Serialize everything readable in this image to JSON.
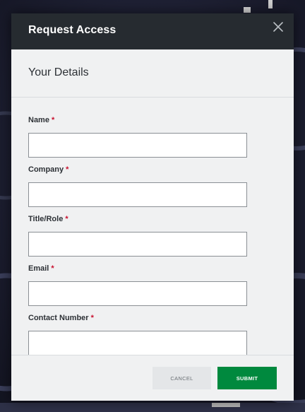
{
  "modal": {
    "title": "Request Access",
    "close_icon": "close-icon",
    "section_title": "Your Details"
  },
  "form": {
    "required_marker": "*",
    "fields": [
      {
        "label": "Name",
        "value": "",
        "placeholder": ""
      },
      {
        "label": "Company",
        "value": "",
        "placeholder": ""
      },
      {
        "label": "Title/Role",
        "value": "",
        "placeholder": ""
      },
      {
        "label": "Email",
        "value": "",
        "placeholder": ""
      },
      {
        "label": "Contact Number",
        "value": "",
        "placeholder": ""
      }
    ]
  },
  "footer": {
    "cancel_label": "CANCEL",
    "submit_label": "SUBMIT"
  },
  "colors": {
    "header_bg": "#262b30",
    "submit_bg": "#00893e",
    "required": "#c8102e"
  }
}
